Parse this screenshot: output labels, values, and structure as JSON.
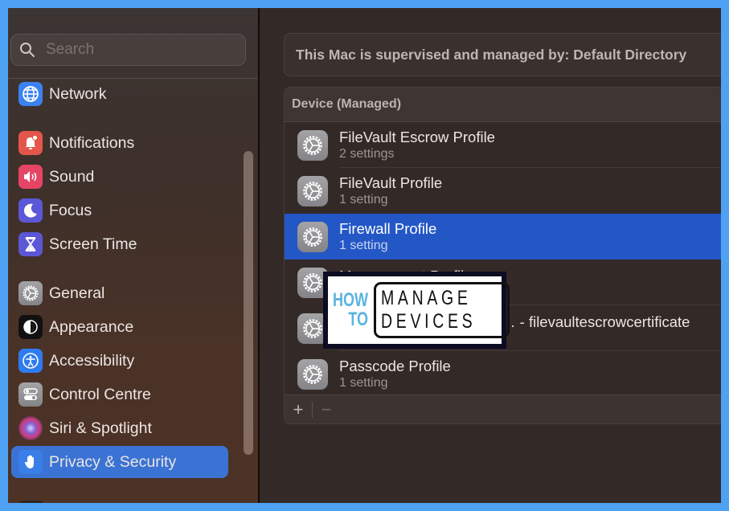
{
  "sidebar": {
    "search": {
      "placeholder": "Search",
      "value": ""
    },
    "items": [
      {
        "label": "Network",
        "icon": "globe-icon",
        "color": "#3b82f0",
        "selected": false
      },
      {
        "label": "Notifications",
        "icon": "bell-icon",
        "color": "#e4564b",
        "selected": false
      },
      {
        "label": "Sound",
        "icon": "speaker-icon",
        "color": "#e54565",
        "selected": false
      },
      {
        "label": "Focus",
        "icon": "moon-icon",
        "color": "#5b57d6",
        "selected": false
      },
      {
        "label": "Screen Time",
        "icon": "hourglass-icon",
        "color": "#5b57d6",
        "selected": false
      },
      {
        "label": "General",
        "icon": "gear-icon",
        "color": "#8e8e92",
        "selected": false
      },
      {
        "label": "Appearance",
        "icon": "appearance-icon",
        "color": "#111111",
        "selected": false
      },
      {
        "label": "Accessibility",
        "icon": "accessibility-icon",
        "color": "#2f7cf0",
        "selected": false
      },
      {
        "label": "Control Centre",
        "icon": "toggles-icon",
        "color": "#8e8e92",
        "selected": false
      },
      {
        "label": "Siri & Spotlight",
        "icon": "siri-icon",
        "color": "#3a2040",
        "selected": false
      },
      {
        "label": "Privacy & Security",
        "icon": "hand-icon",
        "color": "#3a7ee8",
        "selected": true
      }
    ]
  },
  "main": {
    "supervised_text": "This Mac is supervised and managed by: Default Directory",
    "profiles_header": "Device (Managed)",
    "profiles": [
      {
        "title": "FileVault Escrow Profile",
        "subtitle": "2 settings",
        "selected": false
      },
      {
        "title": "FileVault Profile",
        "subtitle": "1 setting",
        "selected": false
      },
      {
        "title": "Firewall Profile",
        "subtitle": "1 setting",
        "selected": true
      },
      {
        "title": "Management Profile",
        "subtitle": "",
        "selected": false
      },
      {
        "title": "… - filevaultescrowcertificate",
        "subtitle": "",
        "selected": false
      },
      {
        "title": "Passcode Profile",
        "subtitle": "1 setting",
        "selected": false
      }
    ],
    "footer": {
      "add_label": "+",
      "remove_label": "−"
    }
  },
  "watermark": {
    "line1": "HOW",
    "line2": "TO",
    "box1": "MANAGE",
    "box2": "DEVICES"
  },
  "colors": {
    "accent_selected_sidebar": "#3a73d4",
    "accent_selected_row": "#2457c6",
    "frame": "#4ea1f3"
  }
}
